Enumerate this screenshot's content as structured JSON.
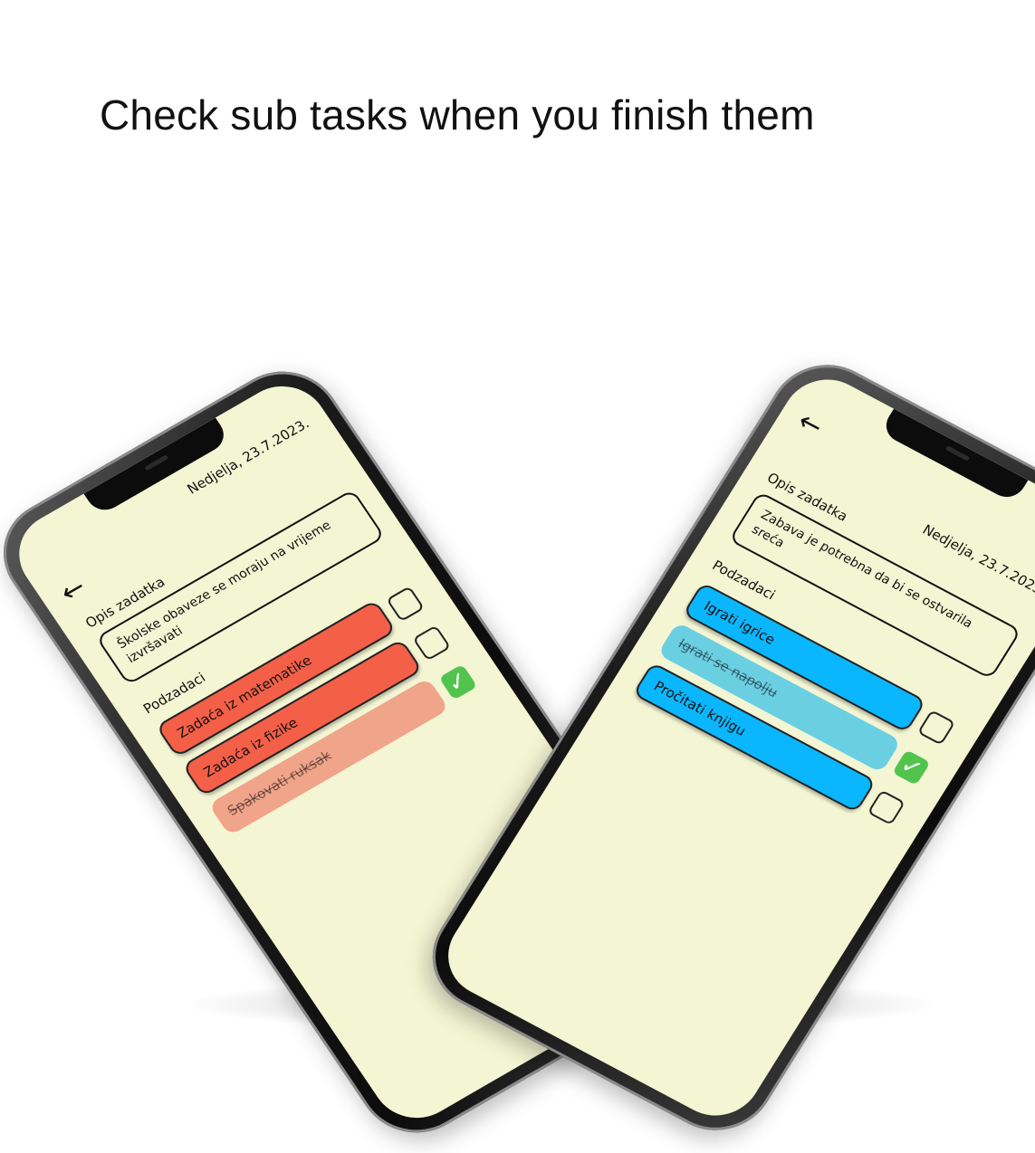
{
  "headline": "Check sub tasks when you finish them",
  "colors": {
    "screen_bg": "#f3f5d3",
    "left_task": "#f45f48",
    "left_task_done": "#f0a48a",
    "right_task": "#0ab7ff",
    "right_task_done": "#6bcfe2",
    "check_green": "#52c44e"
  },
  "left_phone": {
    "date": "Nedjelja, 23.7.2023.",
    "back_icon": "←",
    "description_label": "Opis zadatka",
    "description": "Školske obaveze se moraju na vrijeme izvršavati",
    "subtasks_label": "Podzadaci",
    "subtasks": [
      {
        "label": "Zadaća iz matematike",
        "done": false
      },
      {
        "label": "Zadaća iz fizike",
        "done": false
      },
      {
        "label": "Spakovati ruksak",
        "done": true
      }
    ]
  },
  "right_phone": {
    "date": "Nedjelja, 23.7.2023.",
    "back_icon": "←",
    "description_label": "Opis zadatka",
    "description": "Zabava je potrebna da bi se ostvarila sreća",
    "subtasks_label": "Podzadaci",
    "subtasks": [
      {
        "label": "Igrati igrice",
        "done": false
      },
      {
        "label": "Igrati se napolju",
        "done": true
      },
      {
        "label": "Pročitati knjigu",
        "done": false
      }
    ]
  },
  "check_glyph": "✓"
}
